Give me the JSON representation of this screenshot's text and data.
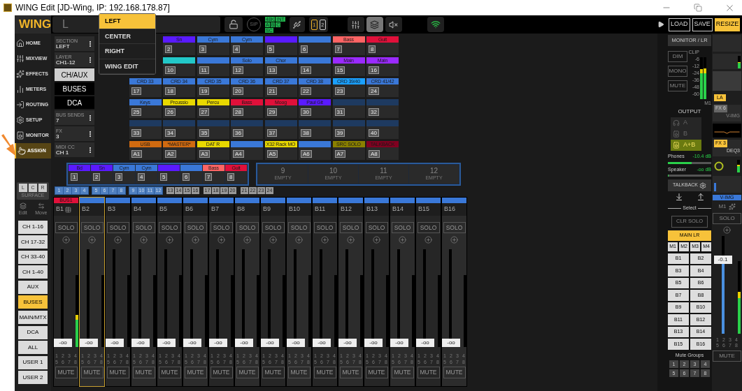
{
  "window": {
    "title": "WING Edit [JD-Wing, IP: 192.168.178.87]"
  },
  "logo": "WING",
  "nav": [
    {
      "label": "HOME",
      "selected": false
    },
    {
      "label": "MIXVIEW",
      "selected": false
    },
    {
      "label": "EFFECTS",
      "selected": false
    },
    {
      "label": "METERS",
      "selected": false
    },
    {
      "label": "ROUTING",
      "selected": false
    },
    {
      "label": "SETUP",
      "selected": false
    },
    {
      "label": "MONITOR",
      "selected": false
    },
    {
      "label": "ASSIGN",
      "selected": true
    }
  ],
  "surface": {
    "buttons": [
      "L",
      "C",
      "R"
    ],
    "label": "SURFACE",
    "edit": "Edit",
    "move": "Move"
  },
  "layers": [
    {
      "label": "CH 1-16",
      "selected": false
    },
    {
      "label": "CH 17-32",
      "selected": false
    },
    {
      "label": "CH 33-40",
      "selected": false
    },
    {
      "label": "CH 1-40",
      "selected": false
    },
    {
      "label": "AUX",
      "selected": false
    },
    {
      "label": "BUSES",
      "selected": true
    },
    {
      "label": "MAIN/MTX",
      "selected": false
    },
    {
      "label": "DCA",
      "selected": false
    },
    {
      "label": "ALL",
      "selected": false
    },
    {
      "label": "USER 1",
      "selected": false
    },
    {
      "label": "USER 2",
      "selected": false
    }
  ],
  "toolbar": {
    "display": "L",
    "sip": "SIP",
    "badges": [
      [
        "48K",
        "INT"
      ],
      [
        "A",
        "B",
        "C"
      ],
      [
        "SC"
      ]
    ],
    "cards": [
      {
        "label": "1",
        "selected": true
      },
      {
        "label": "2",
        "selected": false
      }
    ],
    "views": [
      {
        "selected": false
      },
      {
        "selected": true
      },
      {
        "selected": false
      }
    ]
  },
  "assign_panel": [
    {
      "kind": "select",
      "caption": "SECTION",
      "value": "LEFT"
    },
    {
      "kind": "select",
      "caption": "LAYER",
      "value": "CH1-12"
    },
    {
      "kind": "button",
      "label": "CH/AUX",
      "selected": true
    },
    {
      "kind": "button",
      "label": "BUSES",
      "selected": false
    },
    {
      "kind": "button",
      "label": "DCA",
      "selected": false
    },
    {
      "kind": "select",
      "caption": "BUS SENDS",
      "value": "7"
    },
    {
      "kind": "select",
      "caption": "FX",
      "value": "3"
    },
    {
      "kind": "select",
      "caption": "MIDI CC",
      "value": "CH 1"
    }
  ],
  "section_menu": [
    {
      "label": "LEFT",
      "selected": true
    },
    {
      "label": "CENTER",
      "selected": false
    },
    {
      "label": "RIGHT",
      "selected": false
    },
    {
      "label": "WING EDIT",
      "selected": false
    }
  ],
  "assign_grid": [
    [
      {
        "label": "Sn",
        "color": "#5a1aff",
        "number": "2"
      },
      {
        "label": "Cym",
        "color": "#3a78d8",
        "number": "3"
      },
      {
        "label": "Cym",
        "color": "#3a78d8",
        "number": "4"
      },
      {
        "color": "#5a1aff",
        "number": "5"
      },
      {
        "color": "#3a78d8",
        "number": "6"
      },
      {
        "label": "Bass",
        "color": "#ff6464",
        "number": "7"
      },
      {
        "label": "Guit",
        "color": "#e0103a",
        "number": "8"
      }
    ],
    [
      {
        "color": "#22c8c8",
        "number": "10"
      },
      {
        "color": "#3a78d8",
        "number": "11"
      },
      {
        "label": "Solo",
        "color": "#3a78d8",
        "number": "12"
      },
      {
        "label": "Chor",
        "color": "#3a78d8",
        "number": "13"
      },
      {
        "color": "#3a78d8",
        "number": "14"
      },
      {
        "label": "Main",
        "color": "#9a2aff",
        "number": "15"
      },
      {
        "label": "Main",
        "color": "#9a2aff",
        "number": "16"
      }
    ],
    [
      {
        "label": "CRD 33",
        "color": "#3a78d8",
        "number": "17"
      },
      {
        "label": "CRD 34",
        "color": "#3a78d8",
        "number": "18"
      },
      {
        "label": "CRD 35",
        "color": "#3a78d8",
        "number": "19"
      },
      {
        "label": "CRD 36",
        "color": "#3a78d8",
        "number": "20"
      },
      {
        "label": "CRD 37",
        "color": "#3a78d8",
        "number": "21"
      },
      {
        "label": "CRD 38",
        "color": "#3a78d8",
        "number": "22"
      },
      {
        "label": "CRD 39/40",
        "color": "#1aa0ff",
        "number": "23"
      },
      {
        "label": "CRD 41/42",
        "color": "#3a78d8",
        "number": "24"
      }
    ],
    [
      {
        "label": "Keys",
        "color": "#3a78d8",
        "number": "25"
      },
      {
        "label": "Prcussio",
        "color": "#e8d800",
        "number": "26"
      },
      {
        "label": "Percu",
        "color": "#e8d800",
        "number": "27"
      },
      {
        "label": "Bass",
        "color": "#e0103a",
        "number": "28"
      },
      {
        "label": "Moog",
        "color": "#e0103a",
        "number": "29"
      },
      {
        "label": "Paul Git",
        "color": "#5a1aff",
        "number": "30"
      },
      {
        "color": "#1e3a60",
        "number": "31"
      },
      {
        "color": "#1e3a60",
        "number": "32"
      }
    ],
    [
      {
        "color": "#1e3a60",
        "number": "33"
      },
      {
        "color": "#1e3a60",
        "number": "34"
      },
      {
        "color": "#1e3a60",
        "number": "35"
      },
      {
        "color": "#1e3a60",
        "number": "36"
      },
      {
        "color": "#1e3a60",
        "number": "37"
      },
      {
        "color": "#1e3a60",
        "number": "38"
      },
      {
        "color": "#1e3a60",
        "number": "39"
      },
      {
        "color": "#1e3a60",
        "number": "40"
      }
    ],
    [
      {
        "label": "USB",
        "color": "#d06a10",
        "number": "A1"
      },
      {
        "label": "*MASTER*",
        "color": "#d06a10",
        "number": "A2"
      },
      {
        "label": "DAT R",
        "color": "#e8d800",
        "number": "A3"
      },
      {
        "color": "#3a78d8",
        "number": "A4"
      },
      {
        "label": "X32 Rack MO",
        "color": "#e8d800",
        "number": "A5"
      },
      {
        "color": "#3a78d8",
        "number": "A6"
      },
      {
        "label": "SRC SOLO",
        "color": "#8a8000",
        "number": "A7"
      },
      {
        "label": "TALKBACK",
        "color": "#800020",
        "number": "A8"
      }
    ]
  ],
  "bank": [
    {
      "kind": "channels",
      "cells": [
        {
          "label": "Bd",
          "color": "#5a1aff",
          "number": "1"
        },
        {
          "label": "Sn",
          "color": "#5a1aff",
          "number": "2"
        },
        {
          "label": "Cym",
          "color": "#3a78d8",
          "number": "3"
        },
        {
          "label": "Cym",
          "color": "#3a78d8",
          "number": "4"
        },
        {
          "color": "#5a1aff",
          "number": "5"
        },
        {
          "color": "#3a78d8",
          "number": "6"
        },
        {
          "label": "Bass",
          "color": "#ff6464",
          "number": "7"
        },
        {
          "label": "Guit",
          "color": "#e0103a",
          "number": "8"
        }
      ]
    },
    {
      "kind": "empty",
      "cells": [
        {
          "number": "9",
          "label": "EMPTY"
        },
        {
          "number": "10",
          "label": "EMPTY"
        },
        {
          "number": "11",
          "label": "EMPTY"
        },
        {
          "number": "12",
          "label": "EMPTY"
        }
      ]
    }
  ],
  "layer_banks": [
    {
      "numbers": [
        "1",
        "2",
        "3",
        "4"
      ],
      "selected": true
    },
    {
      "numbers": [
        "5",
        "6",
        "7",
        "8"
      ],
      "selected": true
    },
    {
      "numbers": [
        "9",
        "10",
        "11",
        "12"
      ],
      "selected": true
    },
    {
      "numbers": [
        "13",
        "14",
        "15",
        "16"
      ],
      "selected": false
    },
    {
      "numbers": [
        "17",
        "18",
        "19",
        "20"
      ],
      "selected": false
    },
    {
      "numbers": [
        "21",
        "22",
        "23",
        "24"
      ],
      "selected": false
    }
  ],
  "strips": [
    {
      "header": "BUS1",
      "color": "#e0103a",
      "name": "B1",
      "selected": false,
      "solo": "SOLO",
      "value": "-oo",
      "fader": {
        "level": 0
      },
      "meter": {
        "level": 0.45
      },
      "mute_groups": [
        "1",
        "2",
        "3",
        "4",
        "5",
        "6",
        "7",
        "8"
      ],
      "mute": "MUTE"
    },
    {
      "color": "#3a78d8",
      "name": "B2",
      "selected": true,
      "solo": "SOLO",
      "value": "-oo",
      "fader": {
        "level": 0
      },
      "meter": {
        "level": 0
      },
      "mute_groups": [
        "1",
        "2",
        "3",
        "4",
        "5",
        "6",
        "7",
        "8"
      ],
      "mute": "MUTE"
    },
    {
      "color": "#3a78d8",
      "name": "B3",
      "selected": false,
      "solo": "SOLO",
      "value": "-oo",
      "fader": {
        "level": 0
      },
      "meter": {
        "level": 0
      },
      "mute_groups": [
        "1",
        "2",
        "3",
        "4",
        "5",
        "6",
        "7",
        "8"
      ],
      "mute": "MUTE"
    },
    {
      "color": "#3a78d8",
      "name": "B4",
      "selected": false,
      "solo": "SOLO",
      "value": "-oo",
      "fader": {
        "level": 0
      },
      "meter": {
        "level": 0
      },
      "mute_groups": [
        "1",
        "2",
        "3",
        "4",
        "5",
        "6",
        "7",
        "8"
      ],
      "mute": "MUTE"
    },
    {
      "color": "#3a78d8",
      "name": "B5",
      "selected": false,
      "solo": "SOLO",
      "value": "-oo",
      "fader": {
        "level": 0
      },
      "meter": {
        "level": 0
      },
      "mute_groups": [
        "1",
        "2",
        "3",
        "4",
        "5",
        "6",
        "7",
        "8"
      ],
      "mute": "MUTE"
    },
    {
      "color": "#3a78d8",
      "name": "B6",
      "selected": false,
      "solo": "SOLO",
      "value": "-oo",
      "fader": {
        "level": 0
      },
      "meter": {
        "level": 0
      },
      "mute_groups": [
        "1",
        "2",
        "3",
        "4",
        "5",
        "6",
        "7",
        "8"
      ],
      "mute": "MUTE"
    },
    {
      "color": "#3a78d8",
      "name": "B7",
      "selected": false,
      "solo": "SOLO",
      "value": "-oo",
      "fader": {
        "level": 0
      },
      "meter": {
        "level": 0
      },
      "mute_groups": [
        "1",
        "2",
        "3",
        "4",
        "5",
        "6",
        "7",
        "8"
      ],
      "mute": "MUTE"
    },
    {
      "color": "#3a78d8",
      "name": "B8",
      "selected": false,
      "solo": "SOLO",
      "value": "-oo",
      "fader": {
        "level": 0
      },
      "meter": {
        "level": 0
      },
      "mute_groups": [
        "1",
        "2",
        "3",
        "4",
        "5",
        "6",
        "7",
        "8"
      ],
      "mute": "MUTE"
    },
    {
      "color": "#3a78d8",
      "name": "B9",
      "selected": false,
      "solo": "SOLO",
      "value": "-oo",
      "fader": {
        "level": 0
      },
      "meter": {
        "level": 0
      },
      "mute_groups": [
        "1",
        "2",
        "3",
        "4",
        "5",
        "6",
        "7",
        "8"
      ],
      "mute": "MUTE"
    },
    {
      "color": "#3a78d8",
      "name": "B10",
      "selected": false,
      "solo": "SOLO",
      "value": "-oo",
      "fader": {
        "level": 0
      },
      "meter": {
        "level": 0
      },
      "mute_groups": [
        "1",
        "2",
        "3",
        "4",
        "5",
        "6",
        "7",
        "8"
      ],
      "mute": "MUTE"
    },
    {
      "color": "#3a78d8",
      "name": "B11",
      "selected": false,
      "solo": "SOLO",
      "value": "-oo",
      "fader": {
        "level": 0
      },
      "meter": {
        "level": 0
      },
      "mute_groups": [
        "1",
        "2",
        "3",
        "4",
        "5",
        "6",
        "7",
        "8"
      ],
      "mute": "MUTE"
    },
    {
      "color": "#3a78d8",
      "name": "B12",
      "selected": false,
      "solo": "SOLO",
      "value": "-oo",
      "fader": {
        "level": 0
      },
      "meter": {
        "level": 0
      },
      "mute_groups": [
        "1",
        "2",
        "3",
        "4",
        "5",
        "6",
        "7",
        "8"
      ],
      "mute": "MUTE"
    },
    {
      "color": "#3a78d8",
      "name": "B13",
      "selected": false,
      "solo": "SOLO",
      "value": "-oo",
      "fader": {
        "level": 0
      },
      "meter": {
        "level": 0
      },
      "mute_groups": [
        "1",
        "2",
        "3",
        "4",
        "5",
        "6",
        "7",
        "8"
      ],
      "mute": "MUTE"
    },
    {
      "color": "#3a78d8",
      "name": "B14",
      "selected": false,
      "solo": "SOLO",
      "value": "-oo",
      "fader": {
        "level": 0
      },
      "meter": {
        "level": 0
      },
      "mute_groups": [
        "1",
        "2",
        "3",
        "4",
        "5",
        "6",
        "7",
        "8"
      ],
      "mute": "MUTE"
    },
    {
      "color": "#3a78d8",
      "name": "B15",
      "selected": false,
      "solo": "SOLO",
      "value": "-oo",
      "fader": {
        "level": 0
      },
      "meter": {
        "level": 0
      },
      "mute_groups": [
        "1",
        "2",
        "3",
        "4",
        "5",
        "6",
        "7",
        "8"
      ],
      "mute": "MUTE"
    },
    {
      "color": "#3a78d8",
      "name": "B16",
      "selected": false,
      "solo": "SOLO",
      "value": "-oo",
      "fader": {
        "level": 0
      },
      "meter": {
        "level": 0
      },
      "mute_groups": [
        "1",
        "2",
        "3",
        "4",
        "5",
        "6",
        "7",
        "8"
      ],
      "mute": "MUTE"
    }
  ],
  "top_buttons": [
    {
      "label": "LOAD",
      "selected": false
    },
    {
      "label": "SAVE",
      "selected": false
    },
    {
      "label": "RESIZE",
      "selected": true
    }
  ],
  "monitor": {
    "title": "MONITOR / LR",
    "buttons": [
      "DIM",
      "MONO",
      "MUTE"
    ],
    "scale": [
      "CLIP",
      "-6",
      "-12",
      "-24",
      "-36",
      "-48",
      "-60"
    ],
    "meter_label": "M1",
    "meters": [
      {
        "level": 0.72
      },
      {
        "level": 0.74
      }
    ],
    "output_label": "OUTPUT",
    "outputs": [
      {
        "label": "A",
        "selected": false
      },
      {
        "label": "B",
        "selected": false
      },
      {
        "label": "A+B",
        "selected": true
      }
    ],
    "phones": {
      "label": "Phones",
      "value": "-10.4 dB",
      "level": 0.55
    },
    "speaker": {
      "label": "Speaker",
      "value": "-oo dB",
      "level": 0.02
    },
    "talkback": "TALKBACK",
    "select_label": "Select",
    "clr_solo": "CLR SOLO",
    "mains": [
      {
        "label": "MAIN LR",
        "selected": true
      }
    ],
    "matrix": [
      "M1",
      "M2",
      "M3",
      "M4"
    ],
    "buses": [
      "B1",
      "B2",
      "B3",
      "B4",
      "B5",
      "B6",
      "B7",
      "B8",
      "B9",
      "B10",
      "B11",
      "B12",
      "B13",
      "B14",
      "B15",
      "B16"
    ],
    "mute_groups_label": "Mute Groups",
    "mute_groups": [
      "1",
      "2",
      "3",
      "4",
      "5",
      "6",
      "7",
      "8"
    ]
  },
  "main_strip": {
    "insert_a": "LA",
    "fx_a": "FX 6",
    "fx_a_name": "V-IMG",
    "fx_b": "FX 3",
    "fx_b_name": "DEQ3",
    "header": "V-IMG",
    "name": "M1",
    "solo": "SOLO",
    "value": "-0.1",
    "fader": {
      "level": 0.78
    },
    "meter": {
      "level": 0.58
    },
    "mute_groups": [
      "1",
      "2",
      "3",
      "4",
      "5",
      "6",
      "7",
      "8"
    ],
    "mute": "MUTE"
  }
}
